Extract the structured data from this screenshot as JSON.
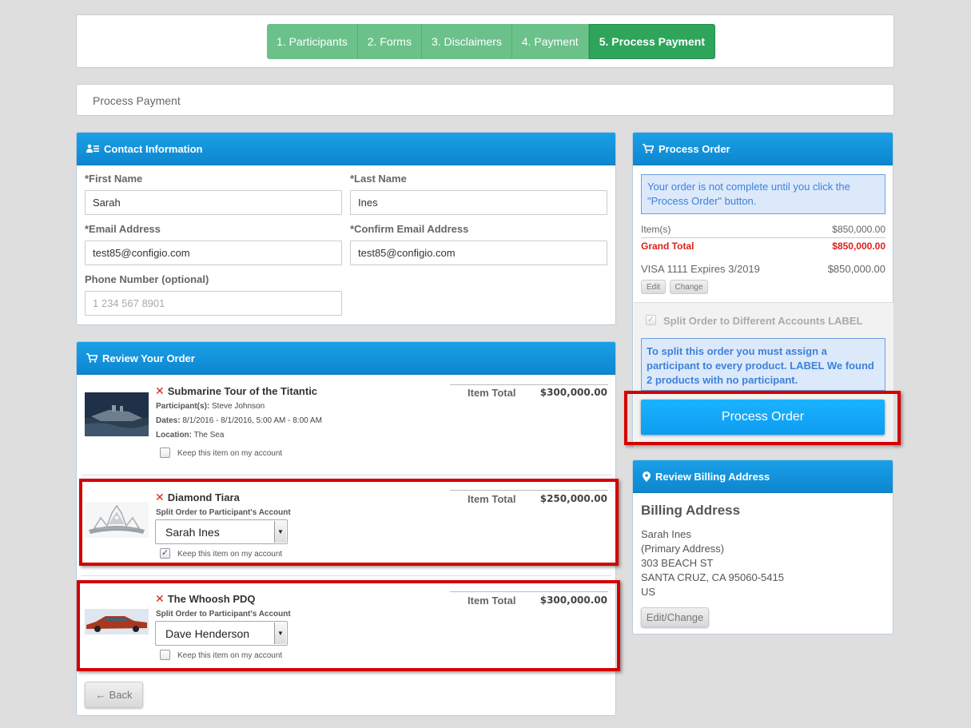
{
  "steps": [
    "1. Participants",
    "2. Forms",
    "3. Disclaimers",
    "4. Payment",
    "5. Process Payment"
  ],
  "breadcrumb": "Process Payment",
  "contact": {
    "title": "Contact Information",
    "first_name_label": "*First Name",
    "first_name_value": "Sarah",
    "last_name_label": "*Last Name",
    "last_name_value": "Ines",
    "email_label": "*Email Address",
    "email_value": "test85@configio.com",
    "confirm_email_label": "*Confirm Email Address",
    "confirm_email_value": "test85@configio.com",
    "phone_label": "Phone Number (optional)",
    "phone_placeholder": "1 234 567 8901"
  },
  "review": {
    "title": "Review Your Order",
    "items": [
      {
        "name": "Submarine Tour of the Titantic",
        "participants_label": "Participant(s):",
        "participants": "Steve Johnson",
        "dates_label": "Dates:",
        "dates": "8/1/2016 - 8/1/2016, 5:00 AM - 8:00 AM",
        "location_label": "Location:",
        "location": "The Sea",
        "item_total_label": "Item Total",
        "item_total": "$300,000.00",
        "keep_label": "Keep this item on my account",
        "keep_checked": false
      },
      {
        "name": "Diamond Tiara",
        "split_label": "Split Order to Participant's Account",
        "participant": "Sarah Ines",
        "item_total_label": "Item Total",
        "item_total": "$250,000.00",
        "keep_label": "Keep this item on my account",
        "keep_checked": true
      },
      {
        "name": "The Whoosh PDQ",
        "split_label": "Split Order to Participant's Account",
        "participant": "Dave Henderson",
        "item_total_label": "Item Total",
        "item_total": "$300,000.00",
        "keep_label": "Keep this item on my account",
        "keep_checked": false
      }
    ],
    "back_label": "Back"
  },
  "order": {
    "title": "Process Order",
    "notice": "Your order is not complete until you click the \"Process Order\" button.",
    "items_label": "Item(s)",
    "items_value": "$850,000.00",
    "grand_total_label": "Grand Total",
    "grand_total_value": "$850,000.00",
    "card_label": "VISA 1111 Expires 3/2019",
    "card_value": "$850,000.00",
    "edit_label": "Edit",
    "change_label": "Change",
    "split_label": "Split Order to Different Accounts LABEL",
    "split_notice": "To split this order you must assign a participant to every product. LABEL We found 2 products with no participant.",
    "process_label": "Process Order"
  },
  "billing": {
    "title": "Review Billing Address",
    "heading": "Billing Address",
    "lines": [
      "Sarah Ines",
      "(Primary Address)",
      "303 BEACH ST",
      "SANTA CRUZ, CA 95060-5415",
      "US"
    ],
    "edit_change_label": "Edit/Change"
  },
  "colors": {
    "header_blue": "#1aa0e8",
    "step_green": "#6bc18a",
    "step_active_green": "#2ea55a",
    "grand_total_red": "#d9221c",
    "highlight_red": "#d40000"
  }
}
